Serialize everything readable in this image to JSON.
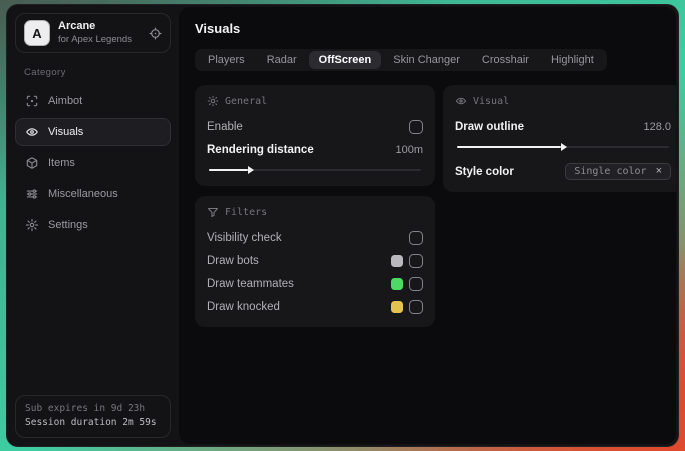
{
  "app": {
    "logo_letter": "A",
    "name": "Arcane",
    "tagline": "for Apex Legends"
  },
  "sidebar": {
    "category_label": "Category",
    "items": [
      {
        "label": "Aimbot"
      },
      {
        "label": "Visuals",
        "active": true
      },
      {
        "label": "Items"
      },
      {
        "label": "Miscellaneous"
      },
      {
        "label": "Settings"
      }
    ],
    "session": {
      "expiry": "Sub expires in 9d 23h",
      "duration": "Session duration 2m 59s"
    }
  },
  "main": {
    "title": "Visuals",
    "tabs": [
      {
        "label": "Players"
      },
      {
        "label": "Radar"
      },
      {
        "label": "OffScreen",
        "active": true
      },
      {
        "label": "Skin Changer"
      },
      {
        "label": "Crosshair"
      },
      {
        "label": "Highlight"
      }
    ],
    "panels": {
      "general": {
        "title": "General",
        "enable_label": "Enable",
        "enable_checked": false,
        "rendering_label": "Rendering distance",
        "rendering_value": "100m",
        "rendering_fill_pct": 20
      },
      "filters": {
        "title": "Filters",
        "rows": [
          {
            "label": "Visibility check",
            "checked": false
          },
          {
            "label": "Draw bots",
            "swatch": "#b9b9bd",
            "checked": false
          },
          {
            "label": "Draw teammates",
            "swatch": "#4cd964",
            "checked": false
          },
          {
            "label": "Draw knocked",
            "swatch": "#e3c24f",
            "checked": false
          }
        ]
      },
      "visual": {
        "title": "Visual",
        "outline_label": "Draw outline",
        "outline_value": "128.0",
        "outline_fill_pct": 50,
        "style_label": "Style color",
        "style_selected": "Single color",
        "clear_glyph": "×"
      }
    }
  }
}
